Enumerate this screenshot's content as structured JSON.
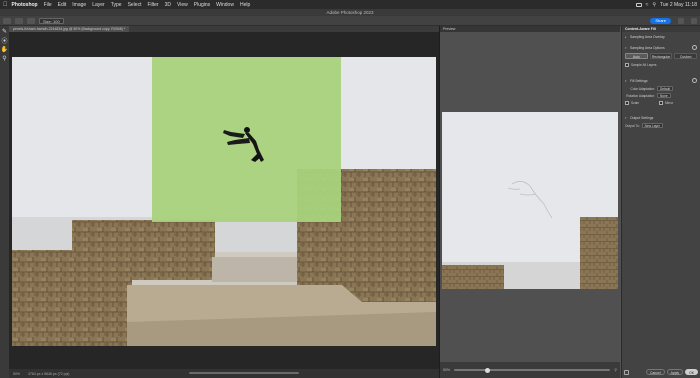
{
  "menubar": {
    "app_name": "Photoshop",
    "items": [
      "File",
      "Edit",
      "Image",
      "Layer",
      "Type",
      "Select",
      "Filter",
      "3D",
      "View",
      "Plugins",
      "Window",
      "Help"
    ],
    "clock": "Tue 2 May  11:18"
  },
  "window": {
    "title": "Adobe Photoshop 2023"
  },
  "options": {
    "size": "Size: 100",
    "share_label": "Share"
  },
  "document": {
    "tab_label": "pexels-hisham-hamdh-2244834.jpg @ 50% (Background copy, RGB/8) *"
  },
  "status": {
    "zoom": "50%",
    "info": "3764 px x 5646 px (72 ppi)"
  },
  "preview": {
    "title": "Preview",
    "zoom": "50%",
    "slider_fraction": 0.2
  },
  "props": {
    "panel_title": "Content-Aware Fill",
    "sampling_overlay": "Sampling Area Overlay",
    "sampling_options": "Sampling Area Options",
    "sampling_buttons": [
      "Auto",
      "Rectangular",
      "Custom"
    ],
    "active_sampling": "Auto",
    "sample_all_layers": "Sample All Layers",
    "fill_settings": "Fill Settings",
    "color_adaptation_label": "Color Adaptation:",
    "color_adaptation_value": "Default",
    "rotation_adaptation_label": "Rotation Adaptation:",
    "rotation_adaptation_value": "None",
    "scale_label": "Scale",
    "mirror_label": "Mirror",
    "output_settings": "Output Settings",
    "output_to_label": "Output To:",
    "output_to_value": "New Layer",
    "cancel_label": "Cancel",
    "apply_label": "Apply",
    "ok_label": "OK"
  },
  "colors": {
    "mask_green": "#a8d27b",
    "share_blue": "#1473e6"
  }
}
